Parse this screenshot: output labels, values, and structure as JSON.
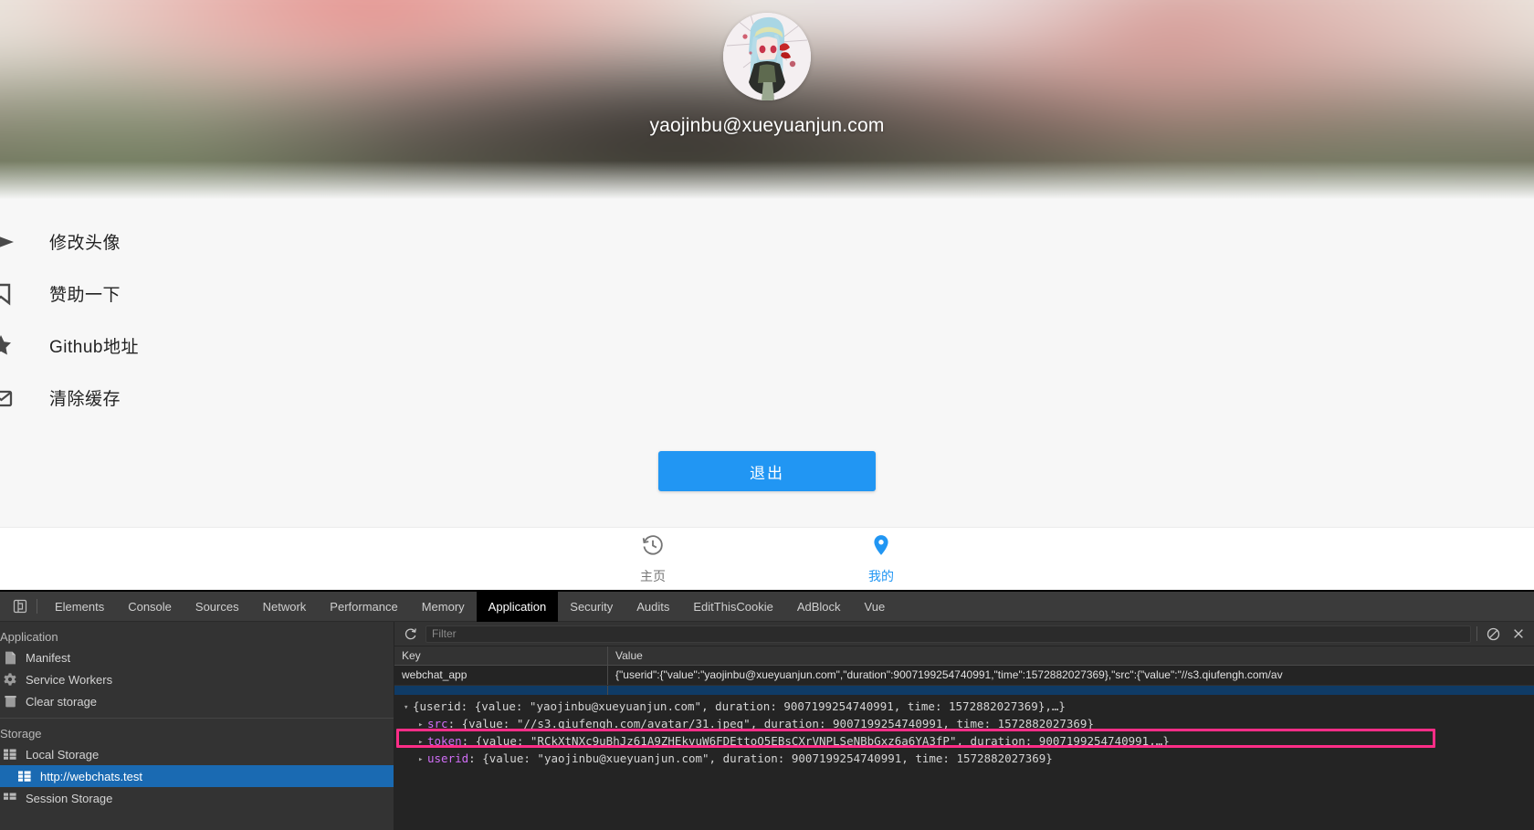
{
  "app": {
    "header": {
      "email": "yaojinbu@xueyuanjun.com",
      "avatar_name": "user-avatar"
    },
    "menu": [
      {
        "label": "修改头像",
        "icon": "send-arrow-icon"
      },
      {
        "label": "赞助一下",
        "icon": "bookmark-icon"
      },
      {
        "label": "Github地址",
        "icon": "star-icon"
      },
      {
        "label": "清除缓存",
        "icon": "envelope-icon"
      }
    ],
    "logout_label": "退出",
    "tabbar": [
      {
        "label": "主页",
        "icon": "history-icon",
        "active": false
      },
      {
        "label": "我的",
        "icon": "location-pin-icon",
        "active": true
      }
    ],
    "accent_color": "#2196f3"
  },
  "devtools": {
    "inspect_icon": "inspect-element-icon",
    "tabs": [
      {
        "label": "Elements",
        "active": false
      },
      {
        "label": "Console",
        "active": false
      },
      {
        "label": "Sources",
        "active": false
      },
      {
        "label": "Network",
        "active": false
      },
      {
        "label": "Performance",
        "active": false
      },
      {
        "label": "Memory",
        "active": false
      },
      {
        "label": "Application",
        "active": true
      },
      {
        "label": "Security",
        "active": false
      },
      {
        "label": "Audits",
        "active": false
      },
      {
        "label": "EditThisCookie",
        "active": false
      },
      {
        "label": "AdBlock",
        "active": false
      },
      {
        "label": "Vue",
        "active": false
      }
    ],
    "sidebar": {
      "section_application": "Application",
      "application_items": [
        {
          "label": "Manifest",
          "icon": "manifest-file-icon"
        },
        {
          "label": "Service Workers",
          "icon": "gear-icon"
        },
        {
          "label": "Clear storage",
          "icon": "trash-icon"
        }
      ],
      "section_storage": "Storage",
      "storage_items": [
        {
          "label": "Local Storage",
          "icon": "table-icon",
          "selected": false
        },
        {
          "label": "http://webchats.test",
          "icon": "table-icon",
          "selected": true
        },
        {
          "label": "Session Storage",
          "icon": "table-icon",
          "selected": false
        }
      ]
    },
    "toolbar": {
      "refresh_icon": "refresh-icon",
      "filter_placeholder": "Filter",
      "filter_value": "",
      "clear_all_icon": "no-entry-icon",
      "delete_icon": "close-x-icon"
    },
    "table": {
      "columns": [
        "Key",
        "Value"
      ],
      "rows": [
        {
          "key": "webchat_app",
          "value": "{\"userid\":{\"value\":\"yaojinbu@xueyuanjun.com\",\"duration\":9007199254740991,\"time\":1572882027369},\"src\":{\"value\":\"//s3.qiufengh.com/av"
        }
      ]
    },
    "preview": {
      "rows": [
        {
          "arrow": "▾",
          "level": 0,
          "prop": "",
          "text": "{userid: {value: \"yaojinbu@xueyuanjun.com\", duration: 9007199254740991, time: 1572882027369},…}",
          "highlighted": false
        },
        {
          "arrow": "▸",
          "level": 1,
          "prop": "src",
          "text": ": {value: \"//s3.qiufengh.com/avatar/31.jpeg\", duration: 9007199254740991, time: 1572882027369}",
          "highlighted": false
        },
        {
          "arrow": "▸",
          "level": 1,
          "prop": "token",
          "text": ": {value: \"RCkXtNXc9uBhJz61A9ZHEkvuW6FDEttoQ5EBsCXrVNPLSeNBbGxz6a6YA3fP\", duration: 9007199254740991,…}",
          "highlighted": true
        },
        {
          "arrow": "▸",
          "level": 1,
          "prop": "userid",
          "text": ": {value: \"yaojinbu@xueyuanjun.com\", duration: 9007199254740991, time: 1572882027369}",
          "highlighted": false
        }
      ],
      "highlight_color": "#ff2d87"
    }
  }
}
